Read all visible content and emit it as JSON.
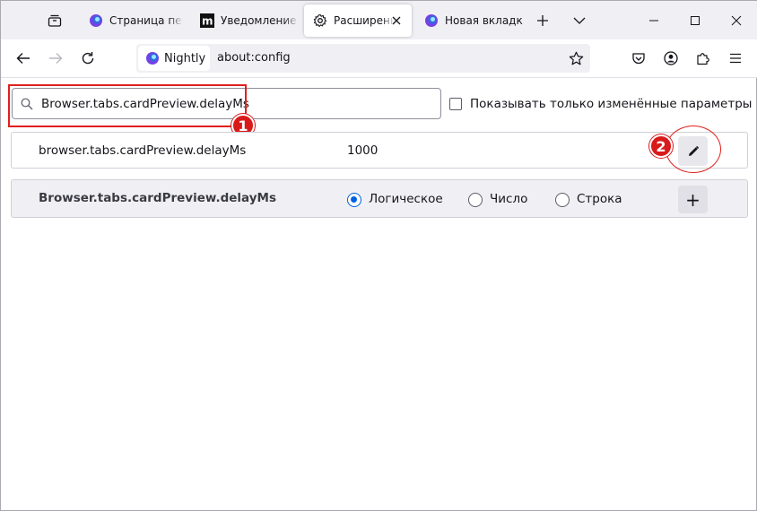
{
  "tabs": [
    {
      "title": "Страница перв",
      "icon": "nightly-icon"
    },
    {
      "title": "Уведомление о",
      "icon": "m-logo-icon"
    },
    {
      "title": "Расширенн",
      "icon": "gear-icon"
    },
    {
      "title": "Новая вкладка",
      "icon": "nightly-icon"
    }
  ],
  "urlbar": {
    "identity_label": "Nightly",
    "url": "about:config"
  },
  "search": {
    "value": "Browser.tabs.cardPreview.delayMs"
  },
  "options": {
    "show_modified_label": "Показывать только изменённые параметры"
  },
  "pref_row": {
    "name": "browser.tabs.cardPreview.delayMs",
    "value": "1000"
  },
  "new_pref_row": {
    "name": "Browser.tabs.cardPreview.delayMs",
    "type_boolean": "Логическое",
    "type_number": "Число",
    "type_string": "Строка",
    "add_label": "+"
  },
  "annotations": {
    "badge1": "1",
    "badge2": "2"
  },
  "colors": {
    "accent": "#0061e0",
    "annotation_red": "#d91a1a",
    "tabstrip_bg": "#f0f0f4"
  }
}
